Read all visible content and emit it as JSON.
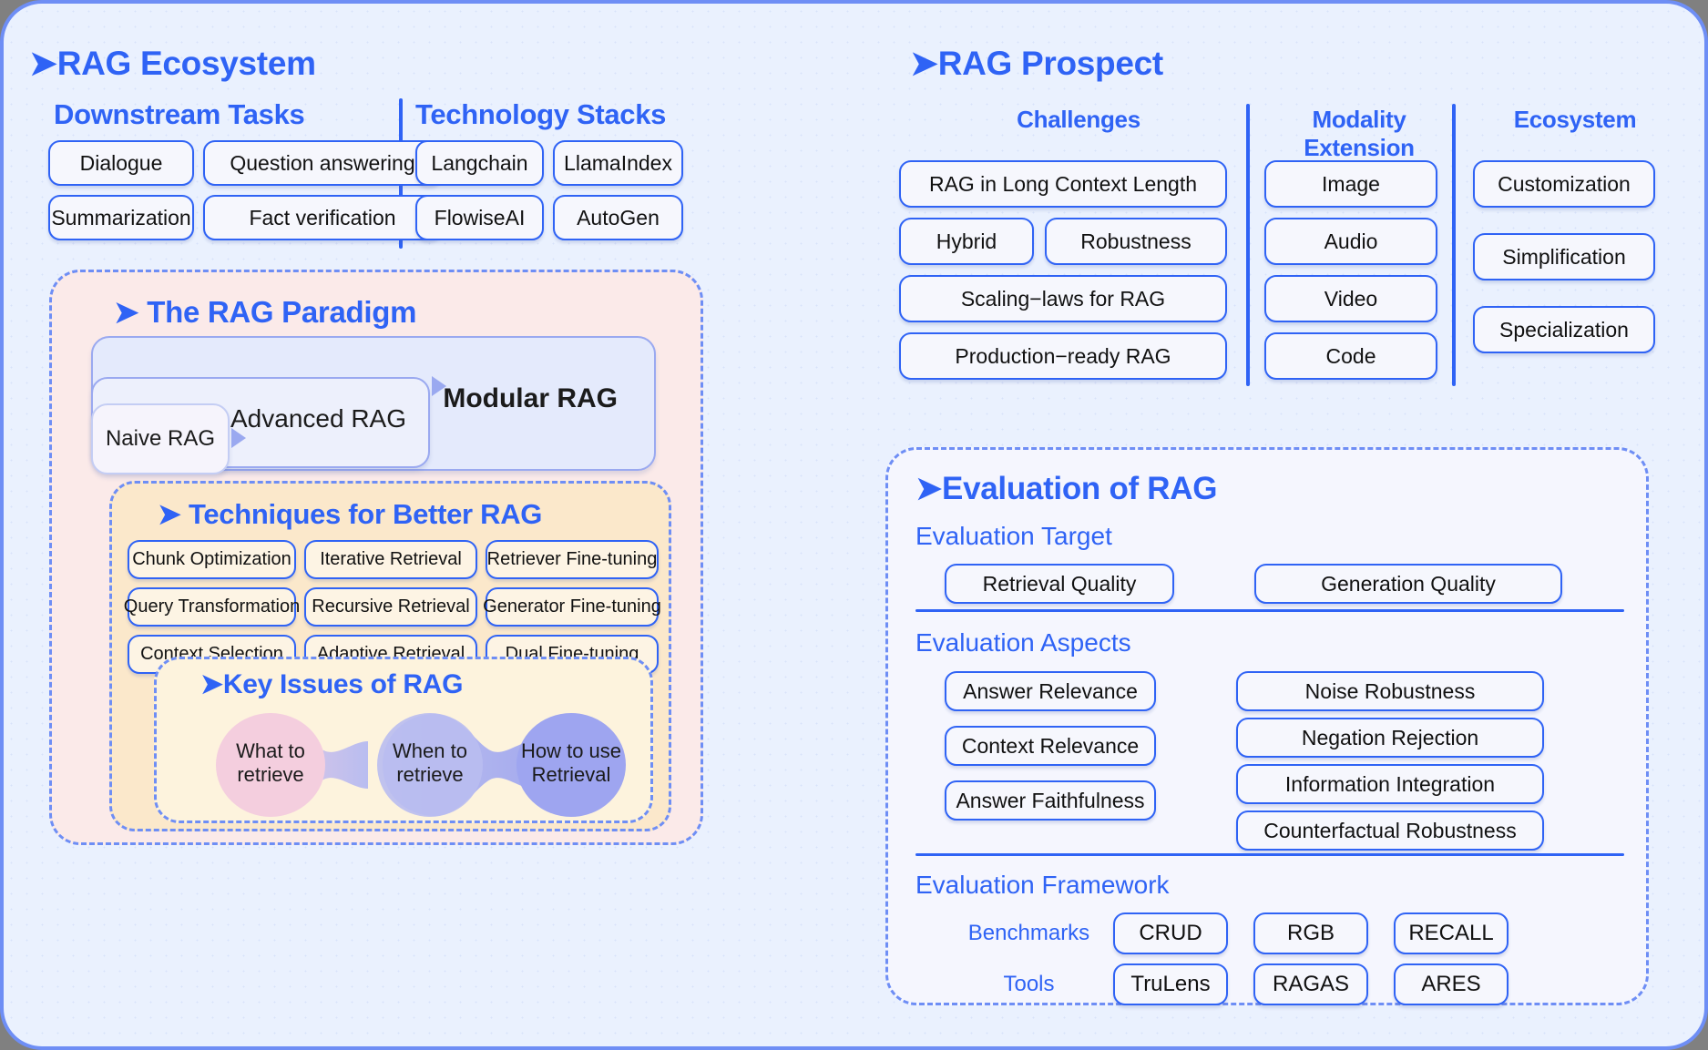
{
  "ecosystem": {
    "title": "RAG Ecosystem",
    "downstream_tasks": {
      "heading": "Downstream Tasks",
      "items": [
        "Dialogue",
        "Question answering",
        "Summarization",
        "Fact verification"
      ]
    },
    "technology_stacks": {
      "heading": "Technology Stacks",
      "items": [
        "Langchain",
        "LlamaIndex",
        "FlowiseAI",
        "AutoGen"
      ]
    }
  },
  "paradigm": {
    "title": "The RAG Paradigm",
    "naive": "Naive RAG",
    "advanced": "Advanced RAG",
    "modular": "Modular RAG",
    "techniques": {
      "title": "Techniques for Better RAG",
      "col1": [
        "Chunk Optimization",
        "Query Transformation",
        "Context Selection"
      ],
      "col2": [
        "Iterative Retrieval",
        "Recursive Retrieval",
        "Adaptive Retrieval"
      ],
      "col3": [
        "Retriever Fine-tuning",
        "Generator Fine-tuning",
        "Dual Fine-tuning"
      ]
    },
    "key_issues": {
      "title": "Key Issues of RAG",
      "blobs": [
        {
          "label": "What to\nretrieve",
          "color": "#f4cede"
        },
        {
          "label": "When to\nretrieve",
          "color": "#b9bdf0"
        },
        {
          "label": "How to use\nRetrieval",
          "color": "#9ea5f0"
        }
      ]
    }
  },
  "prospect": {
    "title": "RAG Prospect",
    "challenges": {
      "heading": "Challenges",
      "items": [
        "RAG in Long Context Length",
        "Hybrid",
        "Robustness",
        "Scaling−laws for RAG",
        "Production−ready RAG"
      ]
    },
    "modality_extension": {
      "heading": "Modality Extension",
      "items": [
        "Image",
        "Audio",
        "Video",
        "Code"
      ]
    },
    "ecosystem": {
      "heading": "Ecosystem",
      "items": [
        "Customization",
        "Simplification",
        "Specialization"
      ]
    }
  },
  "evaluation": {
    "title": "Evaluation of RAG",
    "target": {
      "heading": "Evaluation Target",
      "items": [
        "Retrieval Quality",
        "Generation Quality"
      ]
    },
    "aspects": {
      "heading": "Evaluation Aspects",
      "left": [
        "Answer Relevance",
        "Context Relevance",
        "Answer Faithfulness"
      ],
      "right": [
        "Noise Robustness",
        "Negation Rejection",
        "Information Integration",
        "Counterfactual Robustness"
      ]
    },
    "framework": {
      "heading": "Evaluation Framework",
      "benchmarks_label": "Benchmarks",
      "benchmarks": [
        "CRUD",
        "RGB",
        "RECALL"
      ],
      "tools_label": "Tools",
      "tools": [
        "TruLens",
        "RAGAS",
        "ARES"
      ]
    }
  },
  "colors": {
    "accent": "#2f63f5",
    "canvas_bg": "#eaf1fe",
    "paradigm_bg": "#fbeae9",
    "techniques_bg": "#fbe8cb",
    "keyissues_bg": "#fdf3dd",
    "eval_bg": "#f5f6fe",
    "dashed_border": "#6e8ef5"
  }
}
